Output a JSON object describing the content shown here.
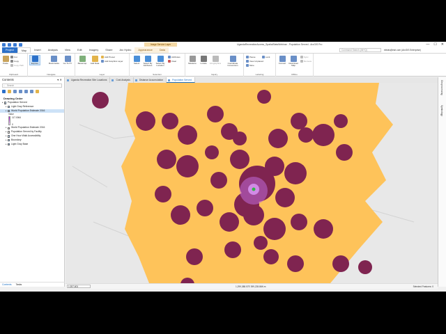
{
  "titlebar": {
    "context_group": "Image Service Layer",
    "document_title": "UgandaRecreationAccess_SpatialStatsWebinar - Population Served - ArcGIS Pro",
    "minimize": "—",
    "maximize": "☐",
    "close": "✕"
  },
  "tabs": [
    "Project",
    "Map",
    "Insert",
    "Analysis",
    "View",
    "Edit",
    "Imagery",
    "Share",
    "Arc Hydro",
    "Appearance",
    "Data"
  ],
  "command_search_placeholder": "Command Search (Alt+Q)",
  "user": "elewis@esri.com (ArcGIS Enterprise)",
  "ribbon": {
    "clipboard": {
      "label": "Clipboard",
      "paste": "Paste",
      "cut": "Cut",
      "copy": "Copy",
      "copy_path": "Copy Path"
    },
    "navigate": {
      "label": "Navigate",
      "explore": "Explore",
      "bookmarks": "Bookmarks",
      "go_to_xy": "Go To XY"
    },
    "layer": {
      "label": "Layer",
      "basemap": "Basemap",
      "add_data": "Add Data",
      "add_preset": "Add Preset",
      "add_graphics_layer": "Add Graphics Layer"
    },
    "selection": {
      "label": "Selection",
      "select": "Select",
      "select_by_attributes": "Select By Attributes",
      "select_by_location": "Select By Location",
      "attributes": "Attributes",
      "clear": "Clear"
    },
    "inquiry": {
      "label": "Inquiry",
      "measure": "Measure",
      "locate": "Locate",
      "infographics": "Infographics",
      "coordinate_conversion": "Coordinate Conversion"
    },
    "labeling": {
      "label": "Labeling",
      "pause": "Pause",
      "view_unplaced": "View Unplaced",
      "lock": "Lock",
      "more": "More"
    },
    "offline": {
      "label": "Offline",
      "convert": "Convert",
      "download_map": "Download Map",
      "sync": "Sync",
      "remove": "Remove"
    }
  },
  "contents": {
    "title": "Contents",
    "search_placeholder": "Search",
    "drawing_order": "Drawing Order",
    "layers": [
      {
        "name": "Population Served",
        "checked": true,
        "indent": 0,
        "selected": false
      },
      {
        "name": "Light Gray Reference",
        "checked": true,
        "indent": 1,
        "selected": false
      },
      {
        "name": "World Population Estimate 2016",
        "checked": true,
        "indent": 1,
        "selected": true
      }
    ],
    "legend_label": "Value",
    "legend_high": "117.0064",
    "legend_low": "0",
    "layers_after": [
      {
        "name": "World Population Estimate 2016",
        "checked": false,
        "indent": 1
      },
      {
        "name": "Population Served by Facility",
        "checked": false,
        "indent": 1
      },
      {
        "name": "One Hour Walk Accessibility",
        "checked": true,
        "indent": 1
      },
      {
        "name": "Boundary",
        "checked": true,
        "indent": 1
      },
      {
        "name": "Light Gray Base",
        "checked": true,
        "indent": 1
      }
    ],
    "bottom_tabs": [
      "Contents",
      "Tasks"
    ]
  },
  "view_tabs": [
    {
      "label": "Uganda Recreation Site Locations",
      "active": false
    },
    {
      "label": "Cost Analysis",
      "active": false
    },
    {
      "label": "Distance Accumulation",
      "active": false
    },
    {
      "label": "Population Served",
      "active": true
    }
  ],
  "right_strip": [
    "Geoprocessing",
    "Symbology"
  ],
  "statusbar": {
    "scale": "1:257,601",
    "coords": "1,299,388.57E 399,228.86N m",
    "selected": "Selected Features: 0"
  },
  "colors": {
    "accent": "#2b70c9",
    "access_area": "#fec35a",
    "service_area": "#7f2450",
    "population": "#b018d6",
    "basemap": "#e8e8e8"
  }
}
